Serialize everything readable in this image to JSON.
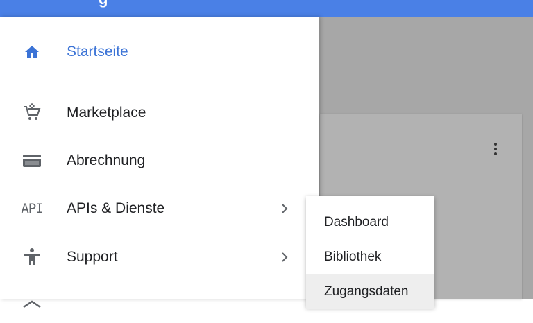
{
  "topbar": {
    "color": "#4a80e6",
    "partial_text": "g"
  },
  "nav": {
    "items": [
      {
        "label": "Startseite",
        "icon": "home-icon",
        "active": true
      },
      {
        "label": "Marketplace",
        "icon": "marketplace-cart-icon"
      },
      {
        "label": "Abrechnung",
        "icon": "billing-card-icon"
      },
      {
        "label": "APIs & Dienste",
        "icon": "api-icon",
        "icon_text": "API",
        "has_submenu": true
      },
      {
        "label": "Support",
        "icon": "support-person-icon",
        "has_submenu": true
      },
      {
        "label": "",
        "icon": "partial-item-icon"
      }
    ]
  },
  "submenu": {
    "items": [
      {
        "label": "Dashboard"
      },
      {
        "label": "Bibliothek"
      },
      {
        "label": "Zugangsdaten",
        "hovered": true
      }
    ]
  },
  "colors": {
    "accent": "#3b73d6",
    "icon_gray": "#5f6368"
  }
}
